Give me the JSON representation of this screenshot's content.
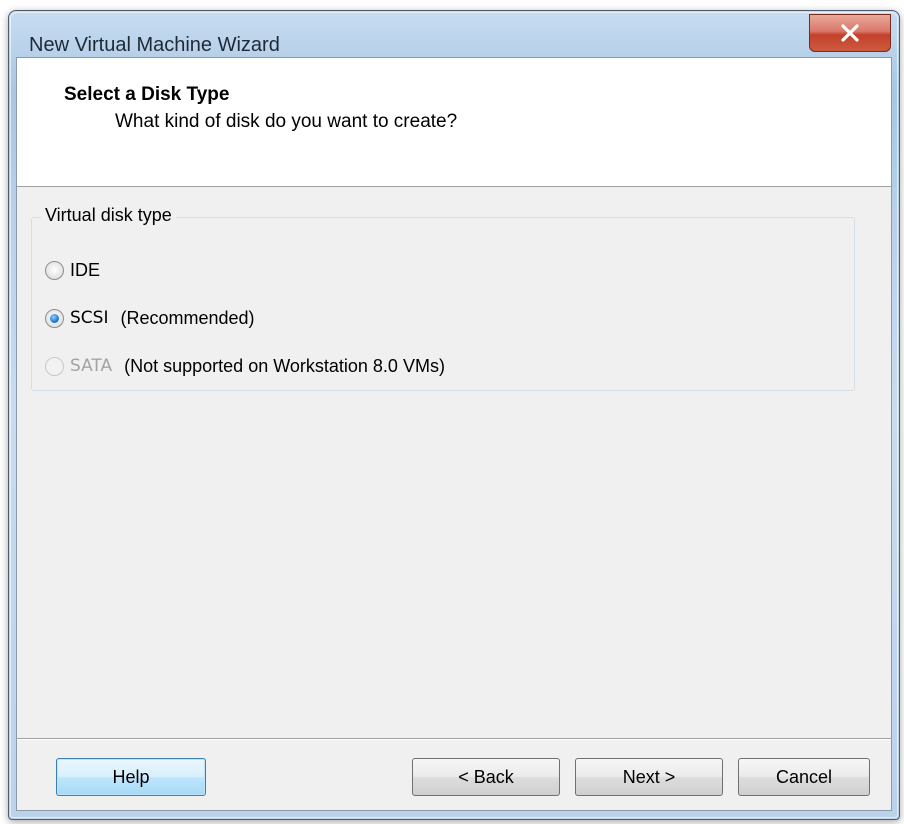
{
  "window": {
    "title": "New Virtual Machine Wizard"
  },
  "header": {
    "title": "Select a Disk Type",
    "subtitle": "What kind of disk do you want to create?"
  },
  "disk_type": {
    "group_label": "Virtual disk type",
    "options": [
      {
        "label": "IDE",
        "note": "",
        "selected": false,
        "enabled": true
      },
      {
        "label": "SCSI",
        "note": "(Recommended)",
        "selected": true,
        "enabled": true
      },
      {
        "label": "SATA",
        "note": "(Not supported on Workstation 8.0 VMs)",
        "selected": false,
        "enabled": false
      }
    ]
  },
  "buttons": {
    "help": "Help",
    "back": "< Back",
    "next": "Next >",
    "cancel": "Cancel"
  },
  "colors": {
    "title_bar": "#b9d2ea",
    "close_button": "#c4412c",
    "default_button_border": "#3c7fb1",
    "radio_selected": "#2a7fd4",
    "disabled_text": "#a3a3a3"
  },
  "icons": {
    "close": "close-icon"
  }
}
